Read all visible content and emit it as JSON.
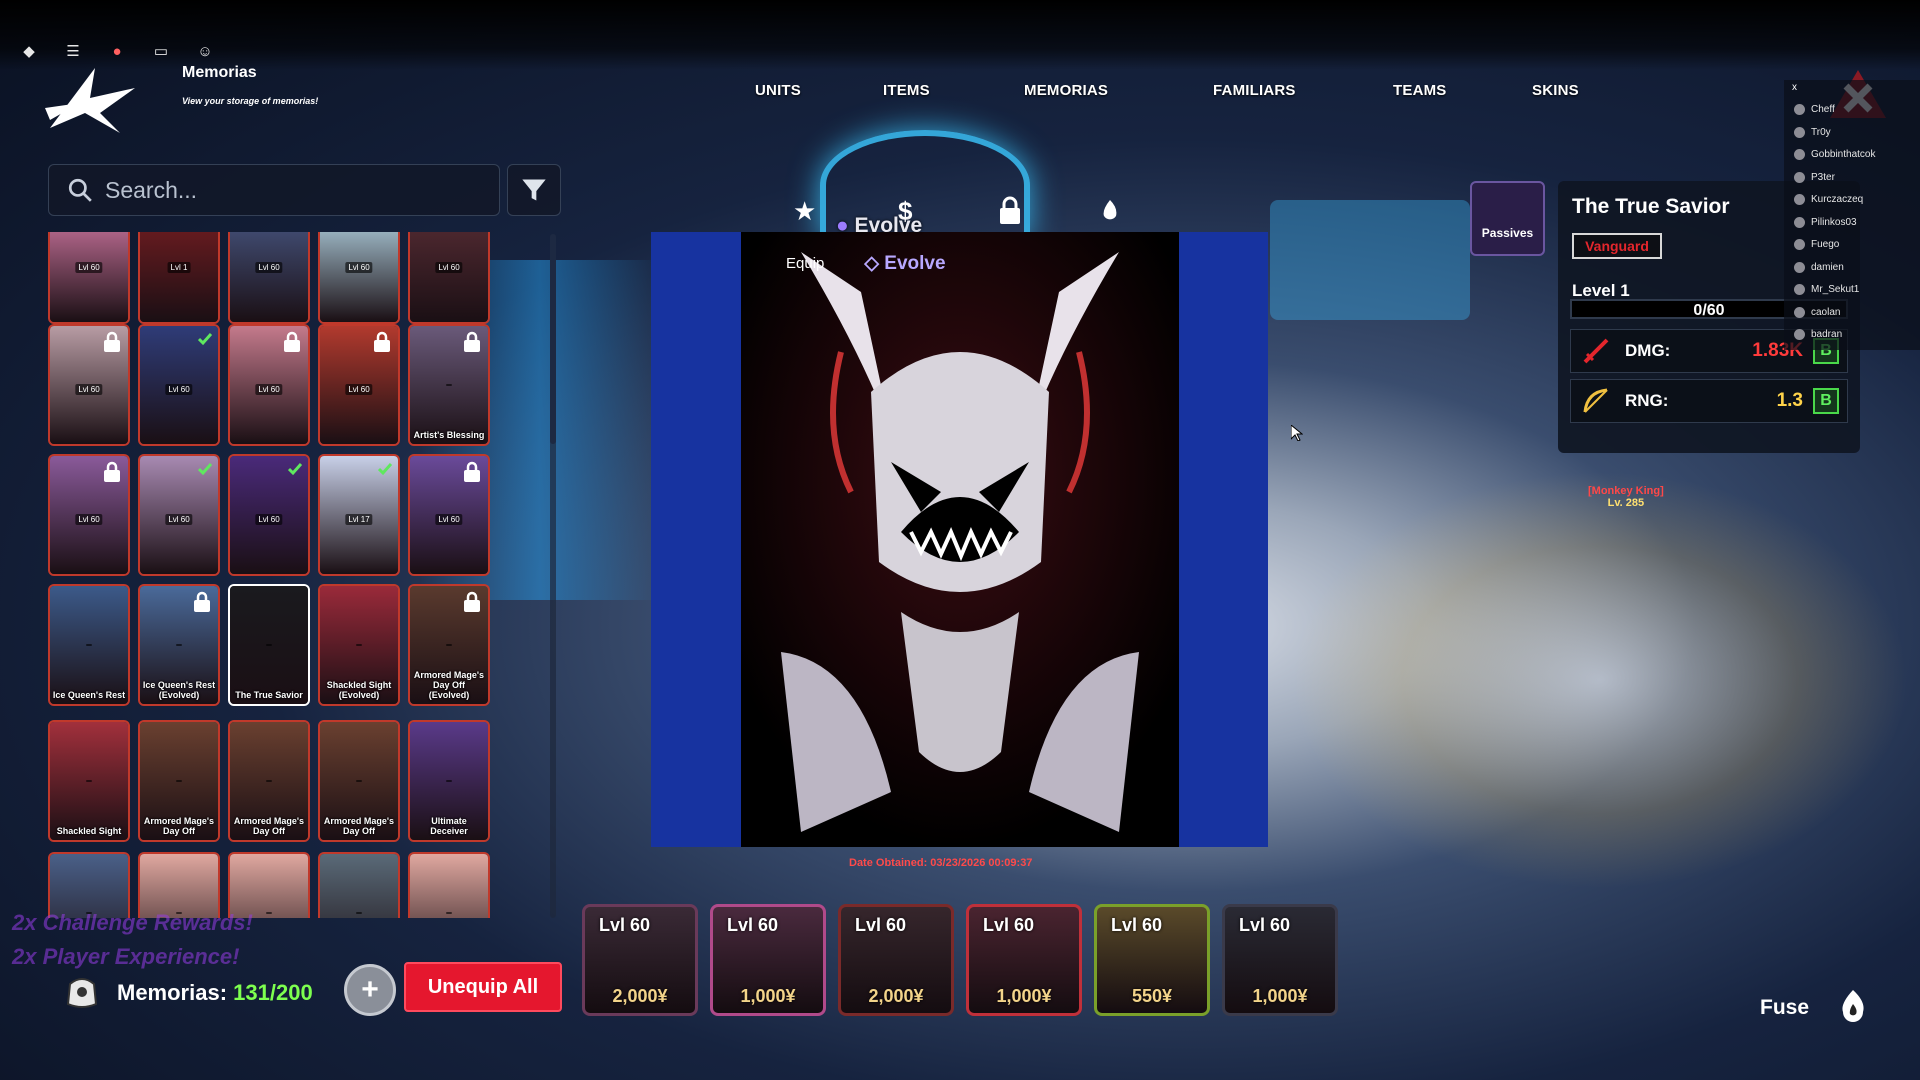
{
  "topbar": {
    "icons": [
      "roblox-icon",
      "menu-icon",
      "mic-icon",
      "chat-icon",
      "profile-icon"
    ]
  },
  "header": {
    "title": "Memorias",
    "subtitle": "View your storage of memorias!"
  },
  "nav": {
    "items": [
      {
        "key": "units",
        "label": "UNITS"
      },
      {
        "key": "items",
        "label": "ITEMS"
      },
      {
        "key": "memorias",
        "label": "MEMORIAS"
      },
      {
        "key": "familiars",
        "label": "FAMILIARS"
      },
      {
        "key": "teams",
        "label": "TEAMS"
      },
      {
        "key": "skins",
        "label": "SKINS"
      }
    ]
  },
  "search": {
    "placeholder": "Search..."
  },
  "grid": {
    "cards": [
      {
        "lvl": "Lvl 60",
        "name": "",
        "color": "#d87ca8"
      },
      {
        "lvl": "Lvl 1",
        "name": "",
        "color": "#7a1e22"
      },
      {
        "lvl": "Lvl 60",
        "name": "",
        "color": "#4a5a88"
      },
      {
        "lvl": "Lvl 60",
        "name": "",
        "color": "#bde0f0"
      },
      {
        "lvl": "Lvl 60",
        "name": "",
        "color": "#5a2e36"
      },
      {
        "lvl": "Lvl 60",
        "name": "",
        "color": "#b89ca4"
      },
      {
        "lvl": "Lvl 60",
        "name": "",
        "color": "#2f3c78"
      },
      {
        "lvl": "Lvl 60",
        "name": "",
        "color": "#c47a8c"
      },
      {
        "lvl": "Lvl 60",
        "name": "",
        "color": "#b23a2e"
      },
      {
        "lvl": "",
        "name": "Artist's Blessing",
        "color": "#6a5a7a"
      },
      {
        "lvl": "Lvl 60",
        "name": "",
        "color": "#8a5a9a"
      },
      {
        "lvl": "Lvl 60",
        "name": "",
        "color": "#a88ab2"
      },
      {
        "lvl": "Lvl 60",
        "name": "",
        "color": "#4a2a7a"
      },
      {
        "lvl": "Lvl 17",
        "name": "",
        "color": "#c8d0e8"
      },
      {
        "lvl": "Lvl 60",
        "name": "",
        "color": "#6a4a9a"
      },
      {
        "lvl": "",
        "name": "Ice Queen's Rest",
        "color": "#3c5a8a"
      },
      {
        "lvl": "",
        "name": "Ice Queen's Rest (Evolved)",
        "color": "#4a6a9a"
      },
      {
        "lvl": "",
        "name": "The True Savior",
        "color": "#1a1a1e"
      },
      {
        "lvl": "",
        "name": "Shackled Sight (Evolved)",
        "color": "#9a2a3a"
      },
      {
        "lvl": "",
        "name": "Armored Mage's Day Off (Evolved)",
        "color": "#5a3a2e"
      },
      {
        "lvl": "",
        "name": "Shackled Sight",
        "color": "#a2303c"
      },
      {
        "lvl": "",
        "name": "Armored Mage's Day Off",
        "color": "#6a4030"
      },
      {
        "lvl": "",
        "name": "Armored Mage's Day Off",
        "color": "#6a4030"
      },
      {
        "lvl": "",
        "name": "Armored Mage's Day Off",
        "color": "#6a4030"
      },
      {
        "lvl": "",
        "name": "Ultimate Deceiver",
        "color": "#5a3a8a"
      },
      {
        "lvl": "",
        "name": "",
        "color": "#4a6088"
      },
      {
        "lvl": "",
        "name": "",
        "color": "#e0a8a0"
      },
      {
        "lvl": "",
        "name": "",
        "color": "#e0a8a0"
      },
      {
        "lvl": "",
        "name": "",
        "color": "#5a6a78"
      },
      {
        "lvl": "",
        "name": "",
        "color": "#e0a8a0"
      }
    ]
  },
  "bonuses": [
    "2x Challenge Rewards!",
    "2x Player Experience!"
  ],
  "footer": {
    "memorias_label": "Memorias:",
    "memorias_count": "131/200",
    "unequip_label": "Unequip All"
  },
  "preview": {
    "tab_equip": "Equip",
    "tab_evolve": "Evolve",
    "evolve_header": "Evolve",
    "date": "Date Obtained: 03/23/2026 00:09:37"
  },
  "units": [
    {
      "lvl": "Lvl 60",
      "cost": "2,000¥",
      "color": "#3a2a36"
    },
    {
      "lvl": "Lvl 60",
      "cost": "1,000¥",
      "color": "#4a2a3e"
    },
    {
      "lvl": "Lvl 60",
      "cost": "2,000¥",
      "color": "#36262c"
    },
    {
      "lvl": "Lvl 60",
      "cost": "1,000¥",
      "color": "#4a2430"
    },
    {
      "lvl": "Lvl 60",
      "cost": "550¥",
      "color": "#5a4a2a"
    },
    {
      "lvl": "Lvl 60",
      "cost": "1,000¥",
      "color": "#2a2a34"
    }
  ],
  "info": {
    "passives_label": "Passives",
    "title": "The True Savior",
    "tag": "Vanguard",
    "level": "Level 1",
    "xp": "0/60",
    "xp_progress": 0,
    "dmg_label": "DMG:",
    "dmg_value": "1.83K",
    "dmg_grade": "B",
    "rng_label": "RNG:",
    "rng_value": "1.3",
    "rng_grade": "B"
  },
  "players": {
    "close": "x",
    "list": [
      "Cheff",
      "Tr0y",
      "Gobbinthatcok",
      "P3ter",
      "Kurczaczeq",
      "Pilinkos03",
      "Fuego",
      "damien",
      "Mr_Sekut1",
      "caolan",
      "badran"
    ]
  },
  "npc": {
    "title": "[Monkey King]",
    "level": "Lv. 285"
  },
  "fuse": {
    "label": "Fuse"
  },
  "colors": {
    "accent_red": "#e5172e",
    "memoria_count_green": "#7dff4f",
    "preview_blue": "#1733a0",
    "grade_green": "#4ad84a"
  }
}
